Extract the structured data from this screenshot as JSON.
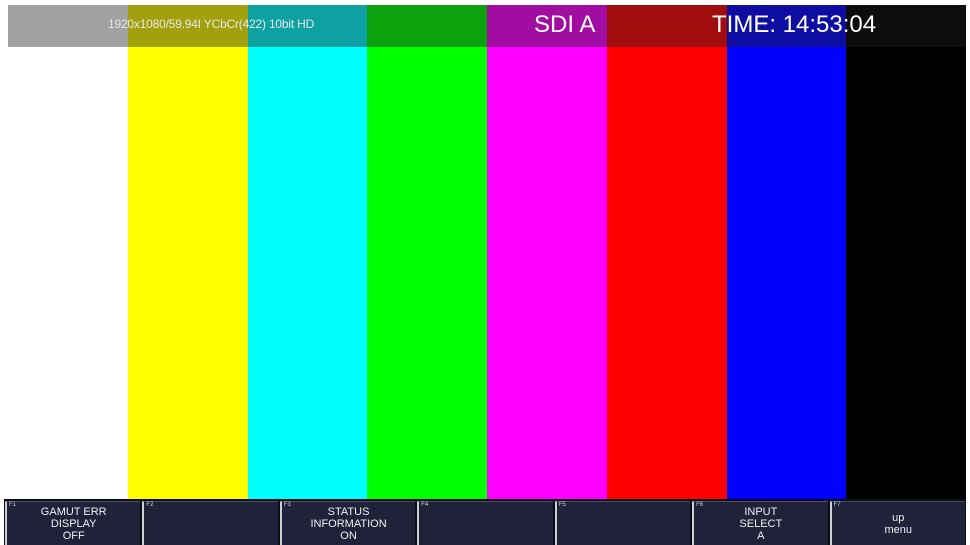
{
  "color_bars": [
    {
      "name": "white",
      "color": "#ffffff"
    },
    {
      "name": "yellow",
      "color": "#ffff00"
    },
    {
      "name": "cyan",
      "color": "#00ffff"
    },
    {
      "name": "green",
      "color": "#00ff00"
    },
    {
      "name": "magenta",
      "color": "#ff00ff"
    },
    {
      "name": "red",
      "color": "#ff0000"
    },
    {
      "name": "blue",
      "color": "#0000ff"
    },
    {
      "name": "black",
      "color": "#000000"
    }
  ],
  "status": {
    "format_info": "1920x1080/59.94I YCbCr(422) 10bit HD",
    "input": "SDI A",
    "time": "TIME: 14:53:04"
  },
  "softkeys": [
    {
      "num": "F1",
      "lines": [
        "GAMUT ERR",
        "DISPLAY",
        "OFF"
      ]
    },
    {
      "num": "F2",
      "lines": []
    },
    {
      "num": "F3",
      "lines": [
        "STATUS",
        "INFORMATION",
        "ON"
      ]
    },
    {
      "num": "F4",
      "lines": []
    },
    {
      "num": "F5",
      "lines": []
    },
    {
      "num": "F6",
      "lines": [
        "INPUT",
        "SELECT",
        "A"
      ]
    },
    {
      "num": "F7",
      "lines": [
        "up",
        "menu"
      ]
    }
  ]
}
